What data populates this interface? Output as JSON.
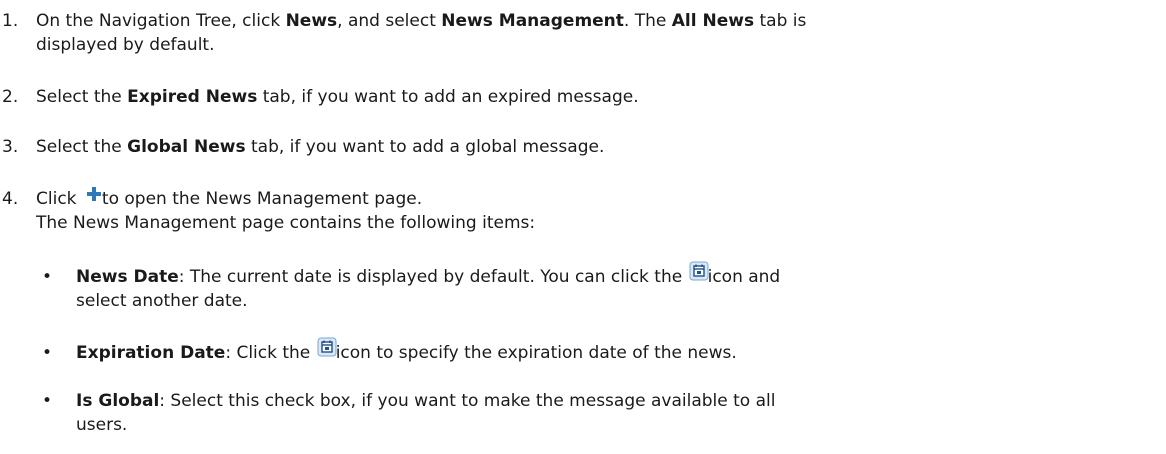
{
  "steps": [
    {
      "num": "1.",
      "t1": "On the Navigation Tree, click ",
      "b1": "News",
      "t2": ", and select ",
      "b2": "News Management",
      "t3": ". The ",
      "b3": "All News",
      "t4": " tab is",
      "t5": "displayed by default."
    },
    {
      "num": "2.",
      "t1": "Select the ",
      "b1": "Expired News",
      "t2": " tab, if you want to add an expired message."
    },
    {
      "num": "3.",
      "t1": "Select the ",
      "b1": "Global News",
      "t2": " tab, if you want to add a global message."
    },
    {
      "num": "4.",
      "t1": "Click ",
      "t2": "to open the News Management page.",
      "t3": "The News Management page contains the following items:"
    }
  ],
  "bullets": [
    {
      "dot": "•",
      "b1": "News Date",
      "t1": ": The current date is displayed by default. You can click the ",
      "t2": "icon and",
      "t3": "select another date."
    },
    {
      "dot": "•",
      "b1": "Expiration Date",
      "t1": ": Click the ",
      "t2": "icon to specify the expiration date of the news."
    },
    {
      "dot": "•",
      "b1": "Is Global",
      "t1": ": Select this check box, if you want to make the message available to all",
      "t2": "users."
    }
  ],
  "icons": {
    "add": "plus-icon",
    "calendar": "calendar-icon"
  },
  "colors": {
    "plus_icon": "#2e7ab8",
    "calendar_border": "#7aa7d6",
    "calendar_fill": "#dbe9f7"
  }
}
